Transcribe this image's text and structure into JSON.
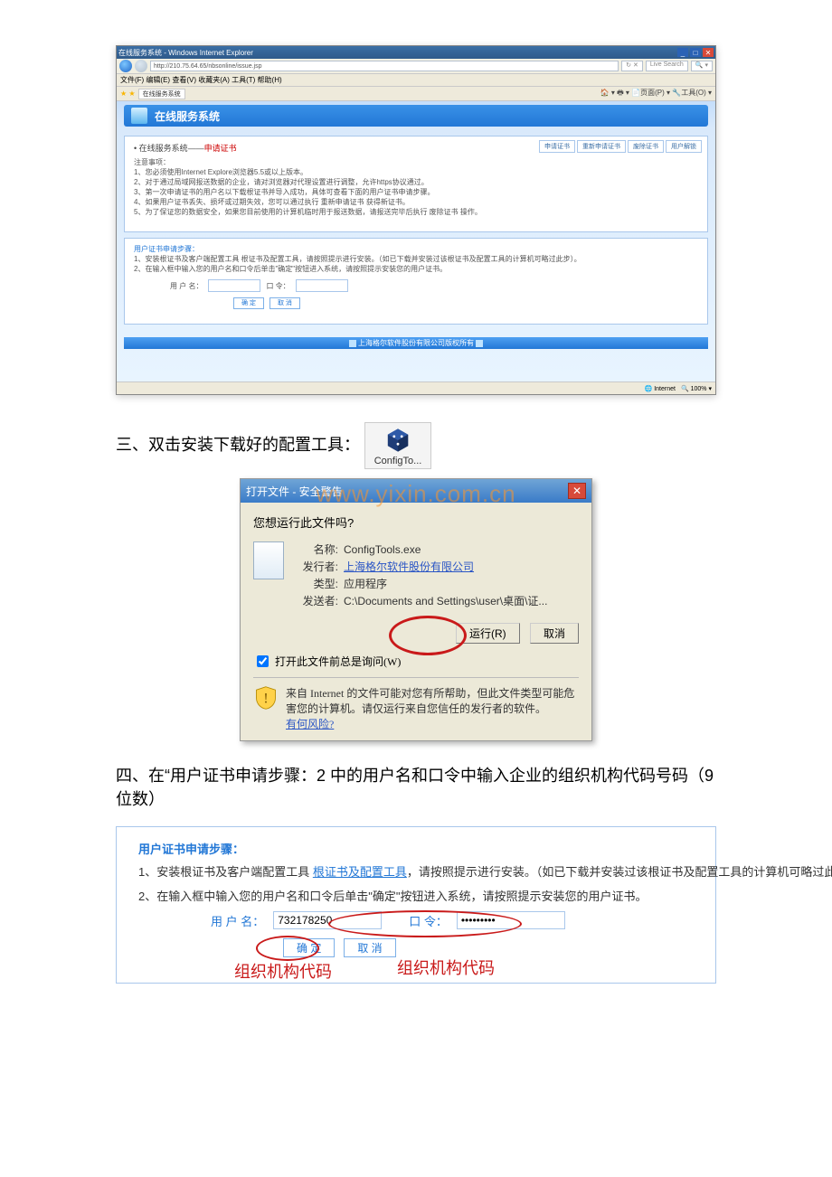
{
  "ie": {
    "window_title": "在线服务系统 - Windows Internet Explorer",
    "url": "http://210.75.64.65/nbsonline/issue.jsp",
    "search_placeholder": "Live Search",
    "menu": "文件(F)  编辑(E)  查看(V)  收藏夹(A)  工具(T)  帮助(H)",
    "tab_label": "在线服务系统",
    "toolbar_right": "🏠 ▾  🖶 ▾  📄页面(P) ▾  🔧工具(O) ▾",
    "sys_title": "在线服务系统",
    "breadcrumb_prefix": "• 在线服务系统——",
    "breadcrumb_active": "申请证书",
    "tabs": [
      "申请证书",
      "重新申请证书",
      "废除证书",
      "用户解锁"
    ],
    "notice_title": "注意事项：",
    "notices": [
      "1、您必须使用Internet Explore浏览器5.5或以上版本。",
      "2、对于通过局域网报送数据的企业，请对浏览器对代理设置进行调整，允许https协议通过。",
      "3、第一次申请证书的用户名以下载根证书并导入成功，具体可查看下面的用户证书申请步骤。",
      "4、如果用户证书丢失、损坏或过期失效，您可以通过执行 重新申请证书 获得新证书。",
      "5、为了保证您的数据安全，如果您目前使用的计算机临时用于报送数据，请报送完毕后执行 废除证书 操作。"
    ],
    "steps_title": "用户证书申请步骤：",
    "step1": "1、安装根证书及客户端配置工具 根证书及配置工具，请按照提示进行安装。（如已下载并安装过该根证书及配置工具的计算机可略过此步）。",
    "step2": "2、在输入框中输入您的用户名和口令后单击\"确定\"按钮进入系统，请按照提示安装您的用户证书。",
    "user_label": "用 户 名：",
    "pass_label": "口 令：",
    "btn_ok": "确 定",
    "btn_cancel": "取 消",
    "footer_strip": "上海格尔软件股份有限公司版权所有",
    "status_net": "Internet",
    "status_zoom": "100%"
  },
  "step3": {
    "text_prefix": "三、双击安装下载好的配置工具：",
    "icon_label": "ConfigTo..."
  },
  "watermark": "www.yixin.com.cn",
  "dlg": {
    "title": "打开文件 - 安全警告",
    "question": "您想运行此文件吗?",
    "name_label": "名称:",
    "name_value": "ConfigTools.exe",
    "issuer_label": "发行者:",
    "issuer_value": "上海格尔软件股份有限公司",
    "type_label": "类型:",
    "type_value": "应用程序",
    "sender_label": "发送者:",
    "sender_value": "C:\\Documents and Settings\\user\\桌面\\证...",
    "run_btn": "运行(R)",
    "cancel_btn": "取消",
    "checkbox": "打开此文件前总是询问(W)",
    "warn_text": "来自 Internet 的文件可能对您有所帮助，但此文件类型可能危害您的计算机。请仅运行来自您信任的发行者的软件。",
    "warn_link": "有何风险?"
  },
  "step4": {
    "text": "四、在“用户证书申请步骤：2 中的用户名和口令中输入企业的组织机构代码号码（9 位数）",
    "panel_title": "用户证书申请步骤：",
    "li1_a": "1、安装根证书及客户端配置工具 ",
    "li1_link": "根证书及配置工具",
    "li1_b": "，请按照提示进行安装。（如已下载并安装过该根证书及配置工具的计算机可略过此步）。",
    "li2": "2、在输入框中输入您的用户名和口令后单击\"确定\"按钮进入系统，请按照提示安装您的用户证书。",
    "user_label": "用 户 名：",
    "user_value": "732178250",
    "pass_label": "口 令：",
    "pass_value": "•••••••••",
    "btn_ok": "确 定",
    "btn_cancel": "取 消",
    "annot1": "组织机构代码",
    "annot2": "组织机构代码"
  }
}
